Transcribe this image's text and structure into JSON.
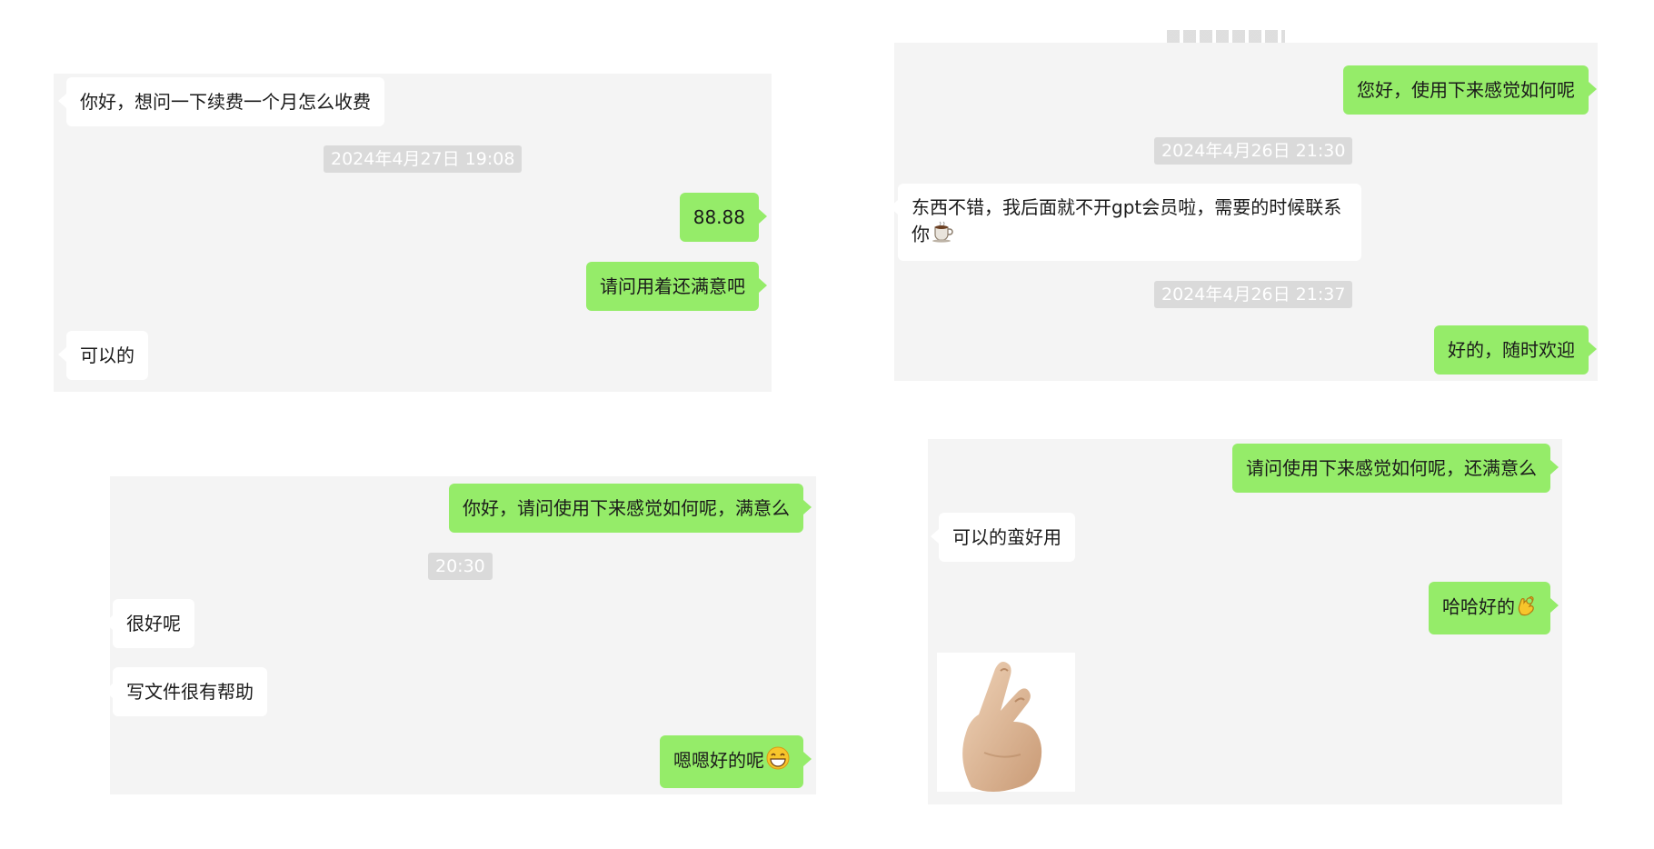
{
  "panel1": {
    "msg1": "你好，想问一下续费一个月怎么收费",
    "ts1": "2024年4月27日 19:08",
    "msg2": "88.88",
    "msg3": "请问用着还满意吧",
    "msg4": "可以的"
  },
  "panel2": {
    "msg1": "您好，使用下来感觉如何呢",
    "ts1": "2024年4月26日 21:30",
    "msg2": "东西不错，我后面就不开gpt会员啦，需要的时候联系你",
    "msg2_emoji": "coffee-icon",
    "ts2": "2024年4月26日 21:37",
    "msg3": "好的，随时欢迎"
  },
  "panel3": {
    "msg1": "你好，请问使用下来感觉如何呢，满意么",
    "ts1": "20:30",
    "msg2": "很好呢",
    "msg3": "写文件很有帮助",
    "msg4": "嗯嗯好的呢",
    "msg4_emoji": "grin-icon"
  },
  "panel4": {
    "msg1": "请问使用下来感觉如何呢，还满意么",
    "msg2": "可以的蛮好用",
    "msg3": "哈哈好的",
    "msg3_emoji": "ok-hand-icon",
    "sticker": "finger-heart-sticker"
  },
  "colors": {
    "panel_bg": "#f4f4f4",
    "bubble_out": "#95ec69",
    "bubble_in": "#ffffff",
    "timestamp_bg": "#dadada"
  }
}
